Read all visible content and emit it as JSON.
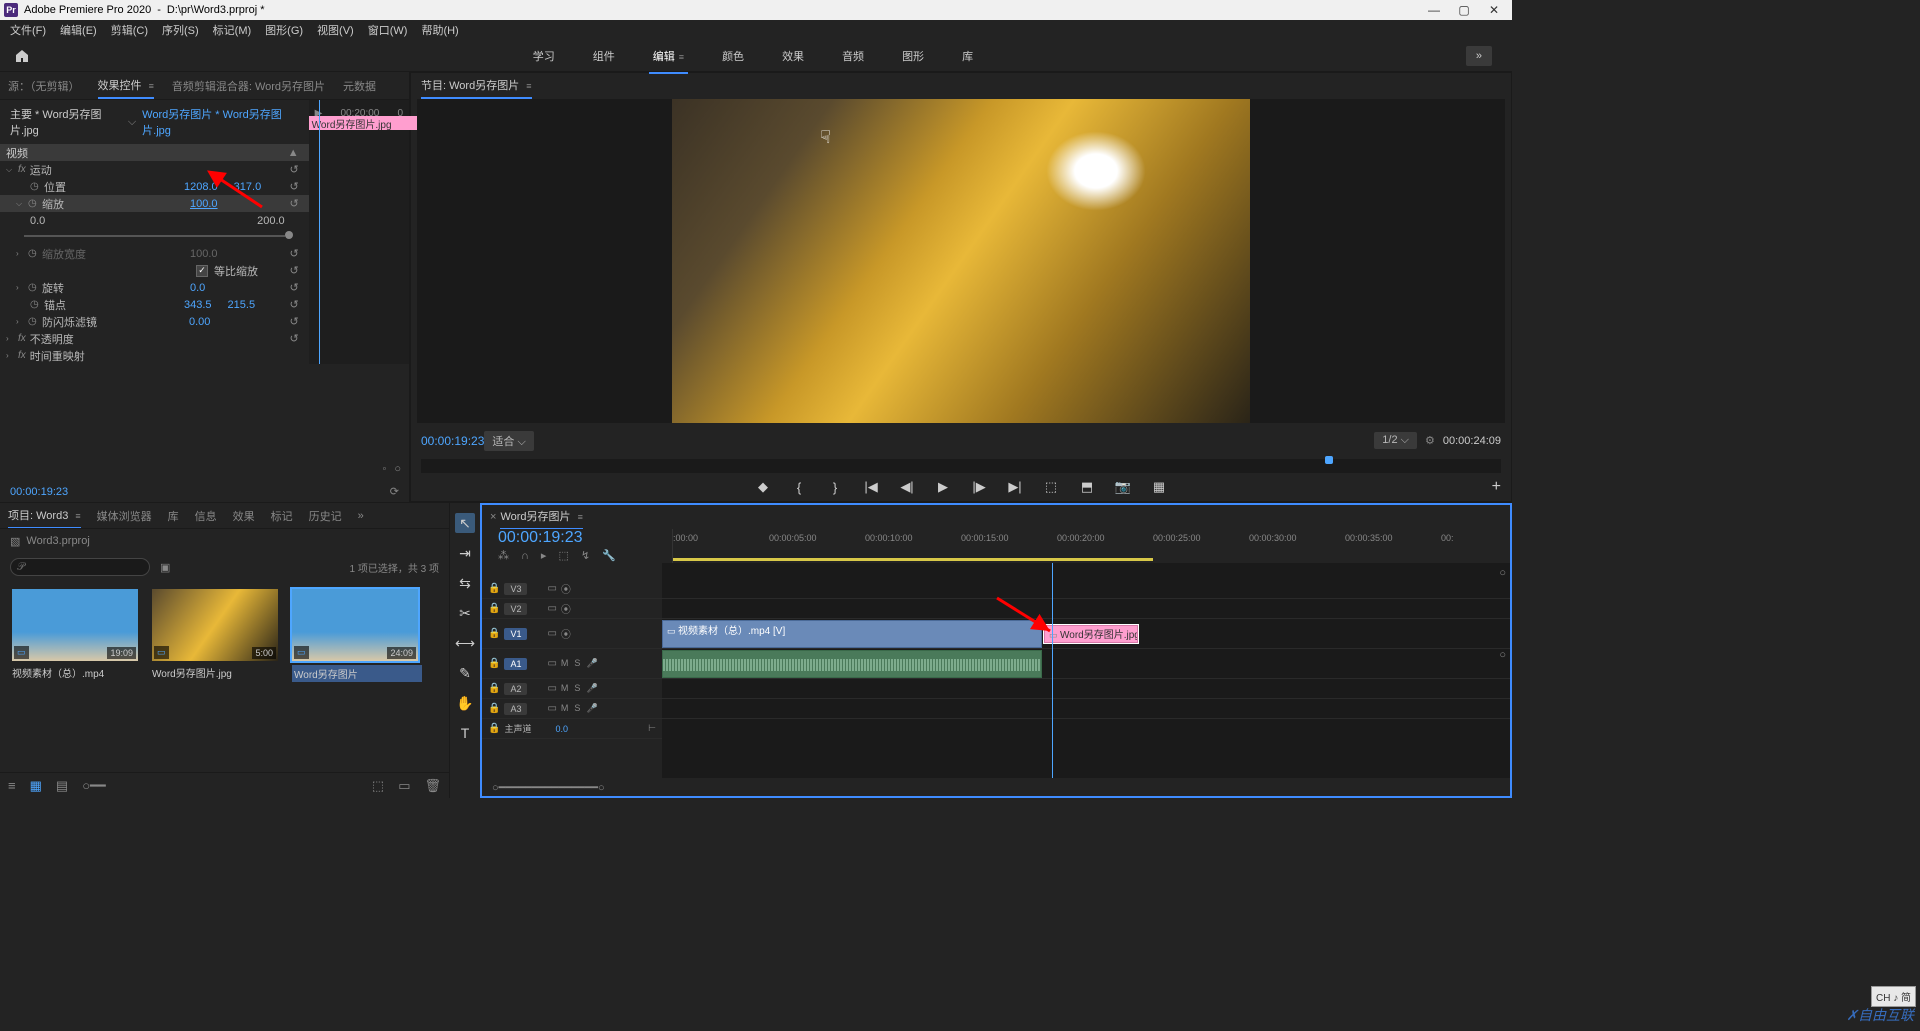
{
  "title_bar": {
    "app": "Adobe Premiere Pro 2020",
    "project_path": "D:\\pr\\Word3.prproj *"
  },
  "menu": [
    "文件(F)",
    "编辑(E)",
    "剪辑(C)",
    "序列(S)",
    "标记(M)",
    "图形(G)",
    "视图(V)",
    "窗口(W)",
    "帮助(H)"
  ],
  "workspaces": {
    "items": [
      "学习",
      "组件",
      "编辑",
      "颜色",
      "效果",
      "音频",
      "图形",
      "库"
    ],
    "active": "编辑",
    "overflow": "»"
  },
  "source": {
    "tabs": [
      "源：（无剪辑）",
      "效果控件",
      "音频剪辑混合器: Word另存图片",
      "元数据"
    ],
    "active_tab": "效果控件",
    "master_label": "主要 * Word另存图片.jpg",
    "clip_link": "Word另存图片 * Word另存图片.jpg",
    "timecode_right": "00:20:00",
    "pink_clip": "Word另存图片.jpg",
    "section_video": "视频",
    "fx_motion": "运动",
    "position": {
      "label": "位置",
      "x": "1208.0",
      "y": "317.0"
    },
    "scale": {
      "label": "缩放",
      "value": "100.0",
      "min": "0.0",
      "max": "200.0"
    },
    "scale_width": {
      "label": "缩放宽度",
      "value": "100.0"
    },
    "uniform": "等比缩放",
    "rotation": {
      "label": "旋转",
      "value": "0.0"
    },
    "anchor": {
      "label": "锚点",
      "x": "343.5",
      "y": "215.5"
    },
    "antiflicker": {
      "label": "防闪烁滤镜",
      "value": "0.00"
    },
    "opacity": "不透明度",
    "time_remap": "时间重映射",
    "current_time": "00:00:19:23"
  },
  "program": {
    "tab": "节目: Word另存图片",
    "current_time": "00:00:19:23",
    "fit": "适合",
    "zoom": "1/2",
    "duration": "00:00:24:09"
  },
  "project": {
    "tabs": [
      "项目: Word3",
      "媒体浏览器",
      "库",
      "信息",
      "效果",
      "标记",
      "历史记"
    ],
    "active": "项目: Word3",
    "file": "Word3.prproj",
    "selection_info": "1 项已选择，共 3 项",
    "items": [
      {
        "name": "视频素材（总）.mp4",
        "dur": "19:09",
        "type": "video"
      },
      {
        "name": "Word另存图片.jpg",
        "dur": "5:00",
        "type": "image"
      },
      {
        "name": "Word另存图片",
        "dur": "24:09",
        "type": "sequence",
        "selected": true
      }
    ]
  },
  "timeline": {
    "tab": "Word另存图片",
    "current_time": "00:00:19:23",
    "ruler": [
      ":00:00",
      "00:00:05:00",
      "00:00:10:00",
      "00:00:15:00",
      "00:00:20:00",
      "00:00:25:00",
      "00:00:30:00",
      "00:00:35:00",
      "00:"
    ],
    "tracks_v": [
      "V3",
      "V2",
      "V1"
    ],
    "tracks_a": [
      "A1",
      "A2",
      "A3"
    ],
    "master": "主声道",
    "master_val": "0.0",
    "clip_video": "视频素材（总）.mp4 [V]",
    "clip_image": "Word另存图片.jpg",
    "ms": {
      "m": "M",
      "s": "S"
    }
  },
  "ime": "CH ♪ 简",
  "watermark": "自由互联"
}
